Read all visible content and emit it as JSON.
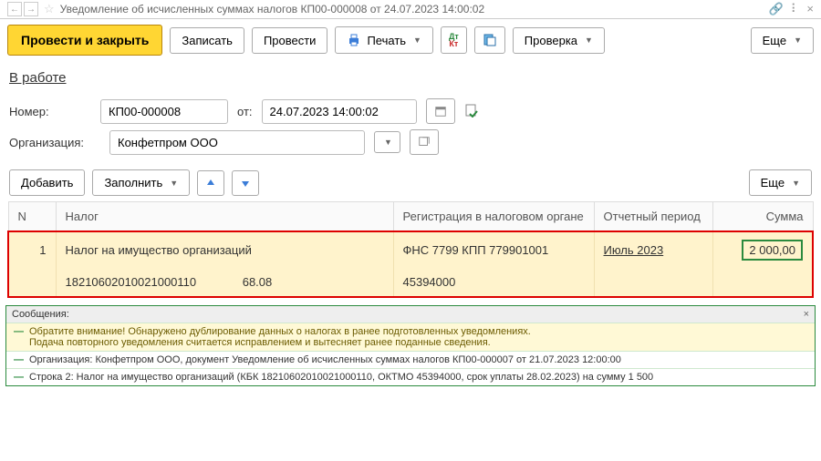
{
  "titlebar": {
    "title": "Уведомление об исчисленных суммах налогов КП00-000008 от 24.07.2023 14:00:02"
  },
  "toolbar": {
    "post_close": "Провести и закрыть",
    "save": "Записать",
    "post": "Провести",
    "print": "Печать",
    "check": "Проверка",
    "more": "Еще"
  },
  "status": "В работе",
  "fields": {
    "number_lbl": "Номер:",
    "number": "КП00-000008",
    "from_lbl": "от:",
    "date": "24.07.2023 14:00:02",
    "org_lbl": "Организация:",
    "org": "Конфетпром ООО"
  },
  "tbar": {
    "add": "Добавить",
    "fill": "Заполнить",
    "more": "Еще"
  },
  "cols": {
    "n": "N",
    "tax": "Налог",
    "reg": "Регистрация в налоговом органе",
    "period": "Отчетный период",
    "sum": "Сумма"
  },
  "row": {
    "n": "1",
    "tax": "Налог на имущество организаций",
    "reg": "ФНС 7799 КПП 779901001",
    "period": "Июль 2023",
    "sum": "2 000,00",
    "kbk": "18210602010021000110",
    "code": "68.08",
    "oktmo": "45394000"
  },
  "msgs": {
    "header": "Сообщения:",
    "m1a": "Обратите внимание! Обнаружено дублирование данных о налогах в ранее подготовленных уведомлениях.",
    "m1b": "Подача повторного уведомления считается исправлением и вытесняет ранее поданные сведения.",
    "m2": "Организация: Конфетпром ООО, документ Уведомление об исчисленных суммах налогов КП00-000007 от 21.07.2023 12:00:00",
    "m3": "Строка 2: Налог на имущество организаций (КБК 18210602010021000110, ОКТМО 45394000, срок уплаты 28.02.2023) на сумму 1 500"
  }
}
